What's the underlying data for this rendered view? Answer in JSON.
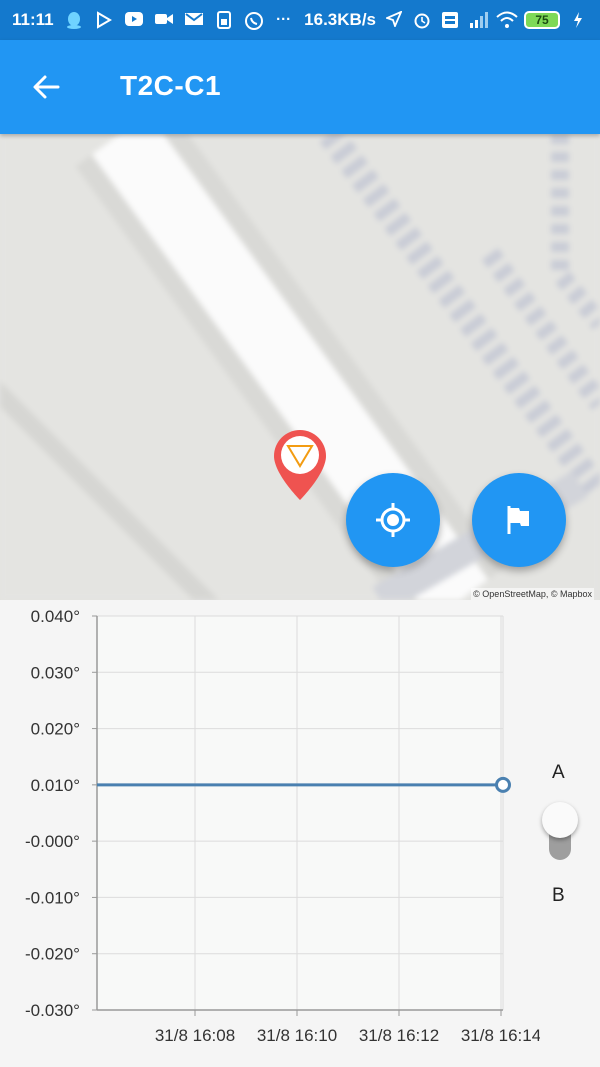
{
  "status_bar": {
    "time": "11:11",
    "net_speed": "16.3KB/s",
    "battery": "75",
    "icons": [
      "qq-icon",
      "play-store-icon",
      "youtube-icon",
      "video-camera-icon",
      "gmail-icon",
      "sim-icon",
      "whatsapp-icon",
      "more-icon",
      "location-arrow-icon",
      "alarm-icon",
      "volte-icon",
      "signal-icon",
      "wifi-icon",
      "battery-icon",
      "charging-icon"
    ],
    "more_glyph": "···"
  },
  "app_bar": {
    "title": "T2C-C1",
    "back_icon": "arrow-back-icon"
  },
  "map": {
    "attribution": "© OpenStreetMap, © Mapbox",
    "marker_icon": "map-pin-icon",
    "marker_color": "#ef5350",
    "locate_icon": "gps-target-icon",
    "flag_icon": "flag-icon"
  },
  "toggle": {
    "label_a": "A",
    "label_b": "B",
    "selected": "A"
  },
  "colors": {
    "primary": "#2196f3",
    "status_bar": "#1479cd",
    "series": "#4a80b0"
  },
  "chart_data": {
    "type": "line",
    "x_ticks": [
      "31/8 16:08",
      "31/8 16:10",
      "31/8 16:12",
      "31/8 16:14"
    ],
    "y_ticks": [
      "0.040°",
      "0.030°",
      "0.020°",
      "0.010°",
      "-0.000°",
      "-0.010°",
      "-0.020°",
      "-0.030°"
    ],
    "ylim": [
      -0.03,
      0.04
    ],
    "series": [
      {
        "values": [
          0.01,
          0.01
        ]
      }
    ],
    "grid": true
  }
}
